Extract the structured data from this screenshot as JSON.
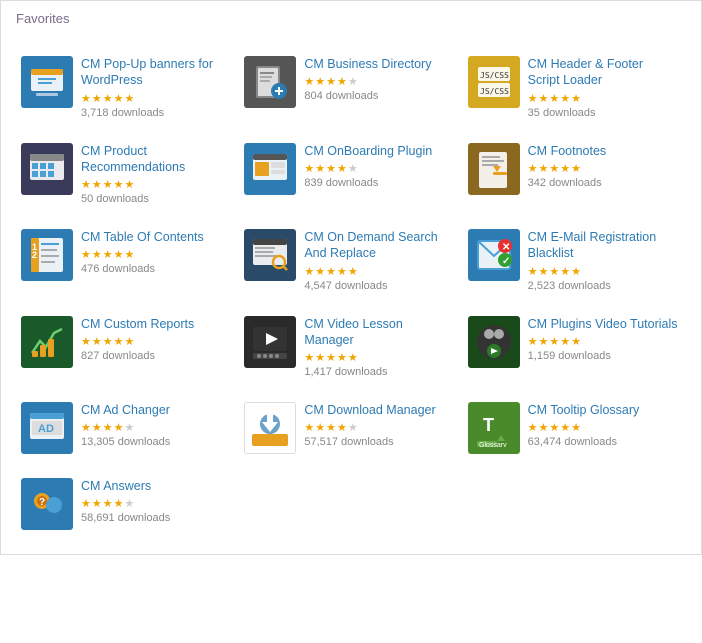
{
  "section": {
    "title": "Favorites"
  },
  "plugins": [
    {
      "id": "popup",
      "name": "CM Pop-Up banners for WordPress",
      "stars": [
        1,
        1,
        1,
        1,
        1
      ],
      "downloads": "3,718 downloads",
      "icon_type": "popup",
      "icon_symbol": "🖥"
    },
    {
      "id": "business",
      "name": "CM Business Directory",
      "stars": [
        1,
        1,
        1,
        1,
        0
      ],
      "downloads": "804 downloads",
      "icon_type": "business",
      "icon_symbol": "📋"
    },
    {
      "id": "header",
      "name": "CM Header & Footer Script Loader",
      "stars": [
        1,
        1,
        1,
        1,
        1
      ],
      "downloads": "35 downloads",
      "icon_type": "header",
      "icon_symbol": "⊞"
    },
    {
      "id": "product",
      "name": "CM Product Recommendations",
      "stars": [
        1,
        1,
        1,
        1,
        1
      ],
      "downloads": "50 downloads",
      "icon_type": "product",
      "icon_symbol": "🖥"
    },
    {
      "id": "onboarding",
      "name": "CM OnBoarding Plugin",
      "stars": [
        1,
        1,
        1,
        0.5,
        0
      ],
      "downloads": "839 downloads",
      "icon_type": "onboarding",
      "icon_symbol": "🖥"
    },
    {
      "id": "footnotes",
      "name": "CM Footnotes",
      "stars": [
        1,
        1,
        1,
        1,
        1
      ],
      "downloads": "342 downloads",
      "icon_type": "footnotes",
      "icon_symbol": "✏"
    },
    {
      "id": "toc",
      "name": "CM Table Of Contents",
      "stars": [
        1,
        1,
        1,
        1,
        1
      ],
      "downloads": "476 downloads",
      "icon_type": "toc",
      "icon_symbol": "📄"
    },
    {
      "id": "search",
      "name": "CM On Demand Search And Replace",
      "stars": [
        1,
        1,
        1,
        1,
        1
      ],
      "downloads": "4,547 downloads",
      "icon_type": "search",
      "icon_symbol": "🔍"
    },
    {
      "id": "email",
      "name": "CM E-Mail Registration Blacklist",
      "stars": [
        1,
        1,
        1,
        1,
        1
      ],
      "downloads": "2,523 downloads",
      "icon_type": "email",
      "icon_symbol": "✉"
    },
    {
      "id": "custom",
      "name": "CM Custom Reports",
      "stars": [
        1,
        1,
        1,
        1,
        1
      ],
      "downloads": "827 downloads",
      "icon_type": "custom",
      "icon_symbol": "📈"
    },
    {
      "id": "video",
      "name": "CM Video Lesson Manager",
      "stars": [
        1,
        1,
        1,
        1,
        1
      ],
      "downloads": "1,417 downloads",
      "icon_type": "video",
      "icon_symbol": "▶"
    },
    {
      "id": "plugins-video",
      "name": "CM Plugins Video Tutorials",
      "stars": [
        1,
        1,
        1,
        1,
        1
      ],
      "downloads": "1,159 downloads",
      "icon_type": "plugins-video",
      "icon_symbol": "🎥"
    },
    {
      "id": "ad",
      "name": "CM Ad Changer",
      "stars": [
        1,
        1,
        1,
        0.5,
        0
      ],
      "downloads": "13,305 downloads",
      "icon_type": "ad",
      "icon_symbol": "🖥"
    },
    {
      "id": "download",
      "name": "CM Download Manager",
      "stars": [
        1,
        1,
        1,
        0.5,
        0
      ],
      "downloads": "57,517 downloads",
      "icon_type": "download",
      "icon_symbol": "⬇"
    },
    {
      "id": "tooltip",
      "name": "CM Tooltip Glossary",
      "stars": [
        1,
        1,
        1,
        1,
        0.5
      ],
      "downloads": "63,474 downloads",
      "icon_type": "tooltip",
      "icon_symbol": "T"
    },
    {
      "id": "answers",
      "name": "CM Answers",
      "stars": [
        1,
        1,
        1,
        0.5,
        0
      ],
      "downloads": "58,691 downloads",
      "icon_type": "answers",
      "icon_symbol": "👥"
    }
  ]
}
